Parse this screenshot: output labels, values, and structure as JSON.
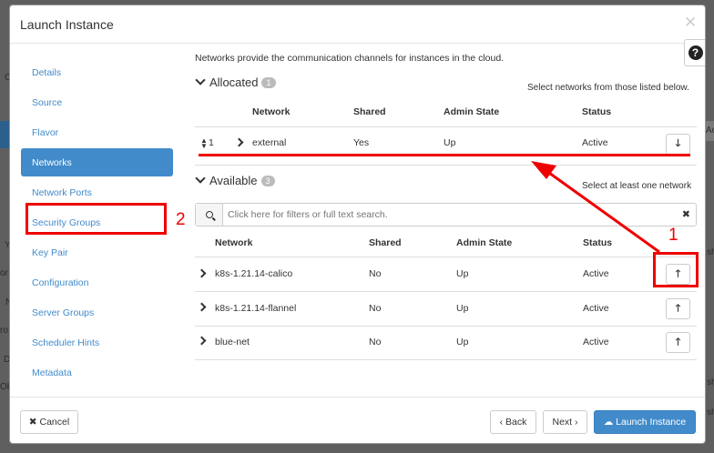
{
  "background": {
    "fragments": [
      "C",
      "Y",
      "or",
      "N",
      "ro",
      "D",
      "Ob",
      "Ac",
      "sh",
      "sh",
      "sh"
    ]
  },
  "modal": {
    "title": "Launch Instance",
    "close_glyph": "✕",
    "help_glyph": "?"
  },
  "nav": {
    "items": [
      {
        "label": "Details",
        "active": false
      },
      {
        "label": "Source",
        "active": false
      },
      {
        "label": "Flavor",
        "active": false
      },
      {
        "label": "Networks",
        "active": true
      },
      {
        "label": "Network Ports",
        "active": false
      },
      {
        "label": "Security Groups",
        "active": false
      },
      {
        "label": "Key Pair",
        "active": false
      },
      {
        "label": "Configuration",
        "active": false
      },
      {
        "label": "Server Groups",
        "active": false
      },
      {
        "label": "Scheduler Hints",
        "active": false
      },
      {
        "label": "Metadata",
        "active": false
      }
    ]
  },
  "networks": {
    "description": "Networks provide the communication channels for instances in the cloud.",
    "allocated": {
      "title": "Allocated",
      "count": "1",
      "hint": "Select networks from those listed below.",
      "columns": [
        "Network",
        "Shared",
        "Admin State",
        "Status"
      ],
      "rows": [
        {
          "order": "1",
          "network": "external",
          "shared": "Yes",
          "admin_state": "Up",
          "status": "Active"
        }
      ]
    },
    "available": {
      "title": "Available",
      "count": "3",
      "hint": "Select at least one network",
      "search_placeholder": "Click here for filters or full text search.",
      "columns": [
        "Network",
        "Shared",
        "Admin State",
        "Status"
      ],
      "rows": [
        {
          "network": "k8s-1.21.14-calico",
          "shared": "No",
          "admin_state": "Up",
          "status": "Active"
        },
        {
          "network": "k8s-1.21.14-flannel",
          "shared": "No",
          "admin_state": "Up",
          "status": "Active"
        },
        {
          "network": "blue-net",
          "shared": "No",
          "admin_state": "Up",
          "status": "Active"
        }
      ]
    }
  },
  "footer": {
    "cancel": "✖ Cancel",
    "back": "‹ Back",
    "next": "Next ›",
    "launch": "☁ Launch Instance"
  },
  "annotations": {
    "label_1": "1",
    "label_2": "2",
    "color": "#ee0000"
  }
}
